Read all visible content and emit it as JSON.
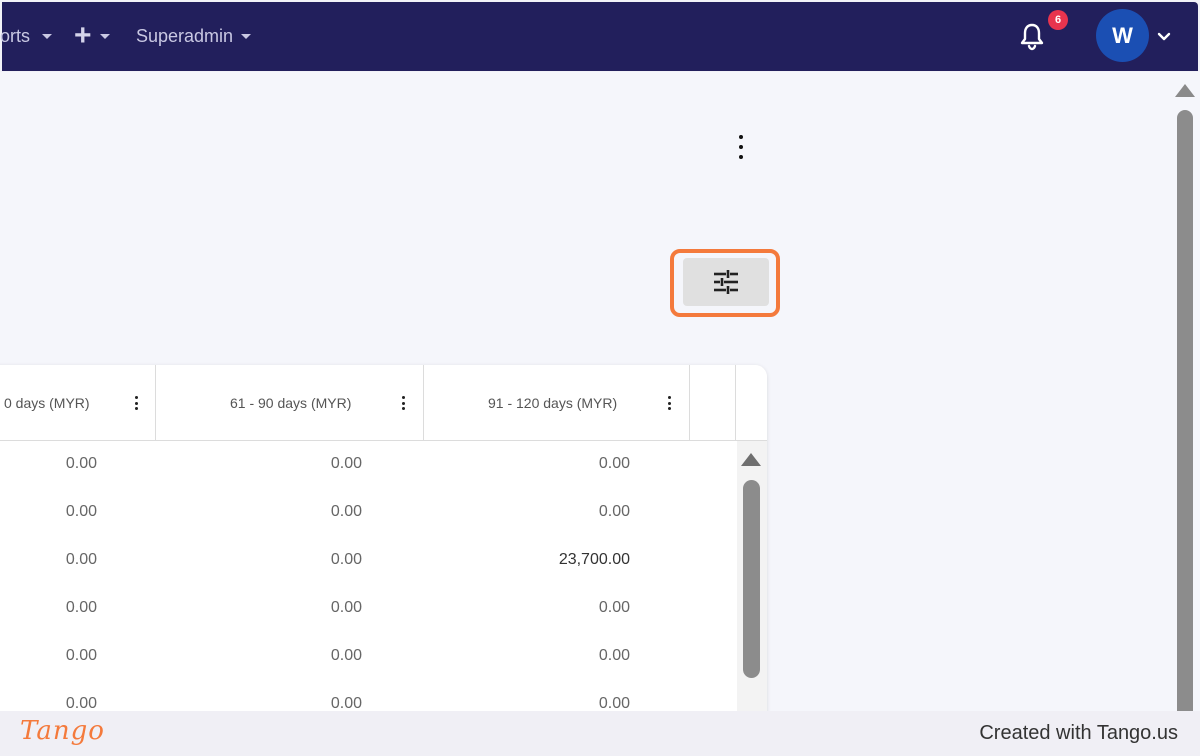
{
  "navbar": {
    "items": [
      {
        "label": "orts"
      },
      {
        "label": "Superadmin"
      }
    ],
    "notifications_count": "6",
    "avatar_initial": "W"
  },
  "table": {
    "columns": [
      {
        "label": "0 days (MYR)"
      },
      {
        "label": "61 - 90 days (MYR)"
      },
      {
        "label": "91 - 120 days (MYR)"
      }
    ],
    "rows": [
      [
        "0.00",
        "0.00",
        "0.00"
      ],
      [
        "0.00",
        "0.00",
        "0.00"
      ],
      [
        "0.00",
        "0.00",
        "23,700.00"
      ],
      [
        "0.00",
        "0.00",
        "0.00"
      ],
      [
        "0.00",
        "0.00",
        "0.00"
      ],
      [
        "0.00",
        "0.00",
        "0.00"
      ]
    ]
  },
  "footer": {
    "logo": "Tango",
    "created_with": "Created with Tango.us"
  },
  "colors": {
    "navbar": "#221f5c",
    "highlight": "#f47a3c",
    "badge": "#e8344e",
    "avatar": "#1b4fb3"
  }
}
